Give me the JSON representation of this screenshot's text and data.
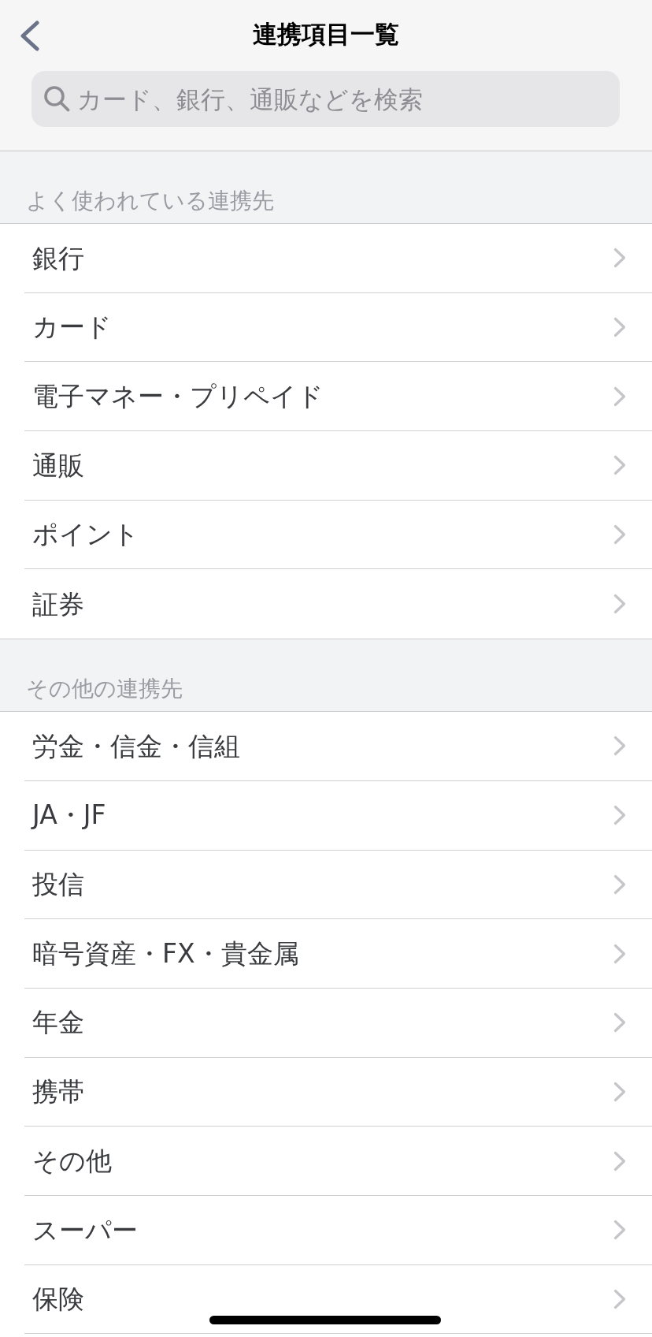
{
  "header": {
    "title": "連携項目一覧",
    "search": {
      "placeholder": "カード、銀行、通販などを検索"
    }
  },
  "sections": [
    {
      "title": "よく使われている連携先",
      "items": [
        "銀行",
        "カード",
        "電子マネー・プリペイド",
        "通販",
        "ポイント",
        "証券"
      ]
    },
    {
      "title": "その他の連携先",
      "items": [
        "労金・信金・信組",
        "JA・JF",
        "投信",
        "暗号資産・FX・貴金属",
        "年金",
        "携帯",
        "その他",
        "スーパー",
        "保険"
      ]
    }
  ]
}
